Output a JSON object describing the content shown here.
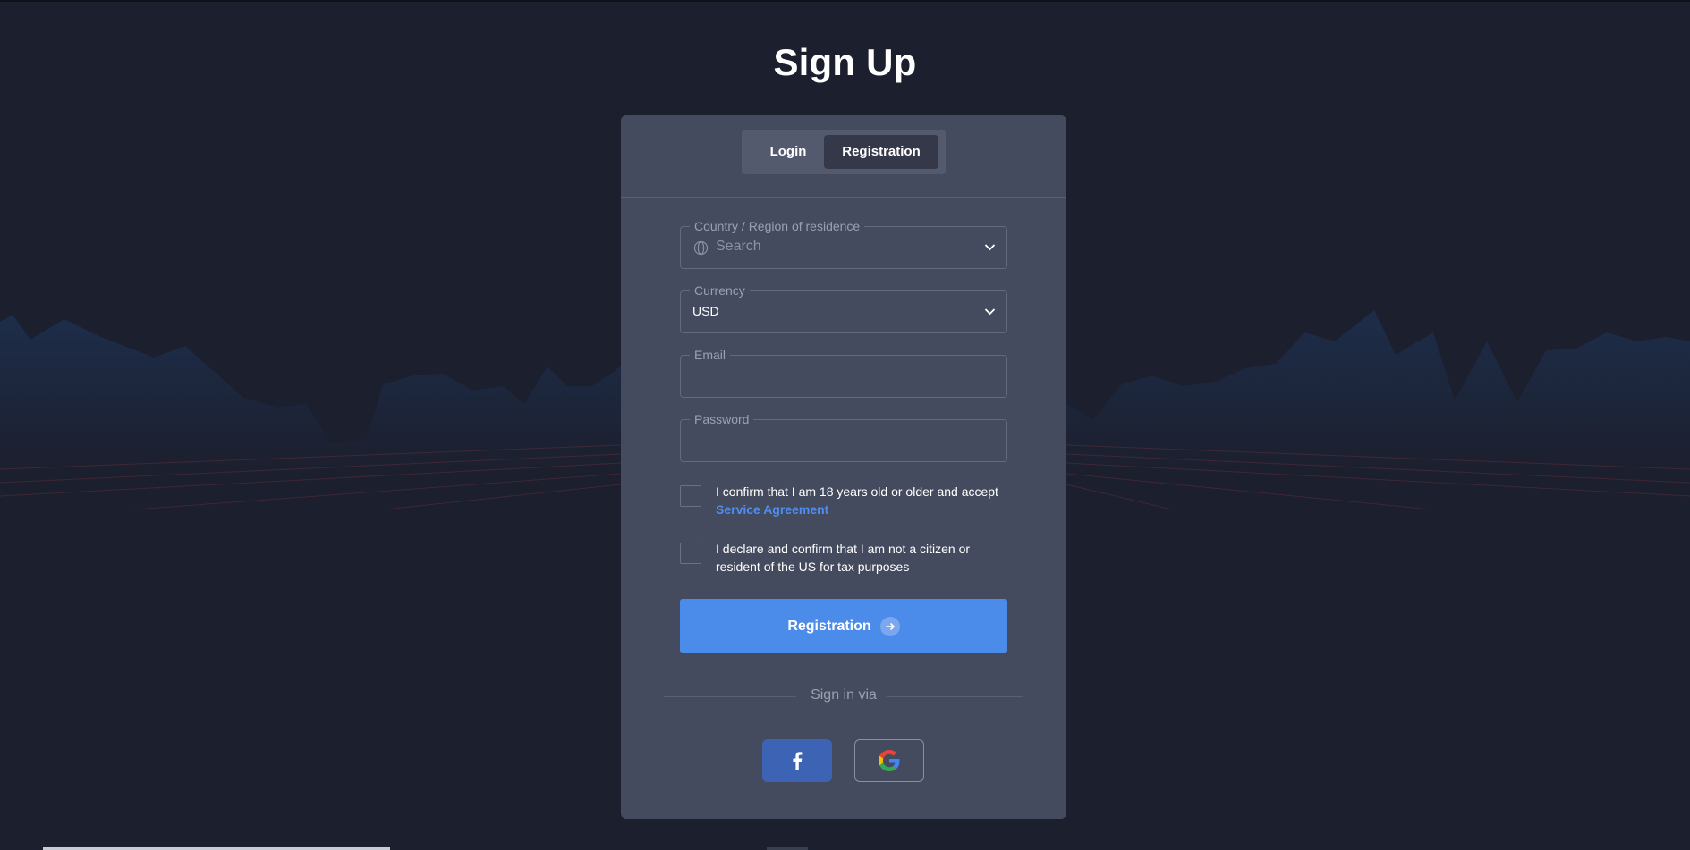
{
  "page": {
    "title": "Sign Up"
  },
  "tabs": {
    "login": "Login",
    "registration": "Registration",
    "active": "Registration"
  },
  "form": {
    "country": {
      "label": "Country / Region of residence",
      "placeholder": "Search"
    },
    "currency": {
      "label": "Currency",
      "value": "USD"
    },
    "email": {
      "label": "Email",
      "value": ""
    },
    "password": {
      "label": "Password",
      "value": ""
    },
    "agree_age": {
      "text": "I confirm that I am 18 years old or older and accept",
      "link": "Service Agreement",
      "checked": false
    },
    "agree_tax": {
      "text": "I declare and confirm that I am not a citizen or resident of the US for tax purposes",
      "checked": false
    },
    "submit_label": "Registration"
  },
  "social": {
    "divider_text": "Sign in via",
    "buttons": [
      {
        "name": "facebook",
        "icon": "facebook-icon",
        "color": "#3d63b5"
      },
      {
        "name": "google",
        "icon": "google-icon"
      }
    ]
  },
  "colors": {
    "background": "#1c1f2d",
    "card": "#454b5e",
    "accent": "#4b8bea",
    "link": "#4d8ef0"
  }
}
